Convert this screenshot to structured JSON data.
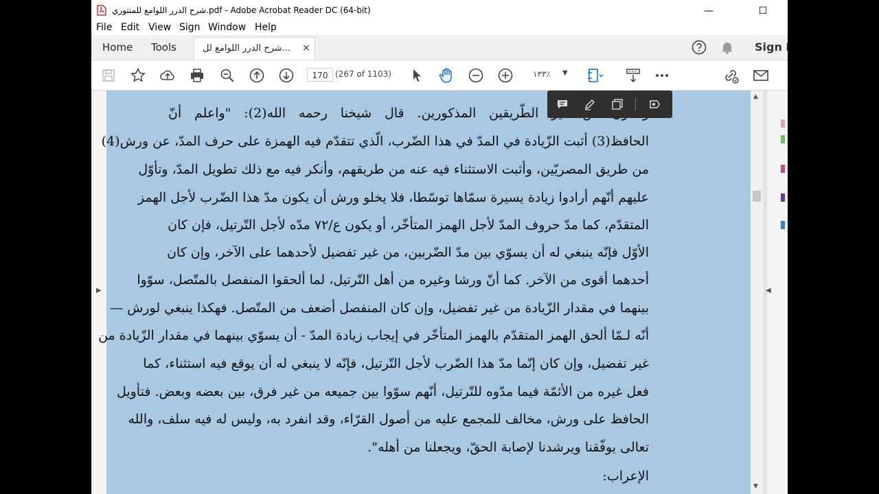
{
  "window": {
    "title": "شرح الدرر اللوامع للمنتوري.pdf - Adobe Acrobat Reader DC (64-bit)",
    "minimize": "—",
    "maximize": "☐"
  },
  "menu": [
    "File",
    "Edit",
    "View",
    "Sign",
    "Window",
    "Help"
  ],
  "tabs": {
    "home": "Home",
    "tools": "Tools",
    "document": "شرح الدرر اللوامع لل...",
    "close": "×",
    "sign_in": "Sign In"
  },
  "toolbar": {
    "page_current": "170",
    "page_count": "(267 of 1103)",
    "zoom": "١٣٣٪",
    "icons": [
      "save-icon",
      "bookmark-star-icon",
      "upload-icon",
      "print-icon",
      "search-zoom-icon",
      "page-up-icon",
      "page-down-icon",
      "select-cursor-icon",
      "hand-tool-icon",
      "zoom-out-icon",
      "zoom-in-icon",
      "page-fit-icon",
      "scroll-mode-icon",
      "more-icon",
      "share-link-icon",
      "email-icon"
    ]
  },
  "comment_bar": {
    "icons": [
      "comment-icon",
      "highlight-pen-icon",
      "copy-icon",
      "convert-icon"
    ]
  },
  "document_text": {
    "lines": [
      "وقالون من غير الطّريقين المذكورين. قال شيخنا رحمه الله(2): \"واعلم أنّ",
      "الحافظ(3) أثبت الزّيادة في المدّ في هذا الضّرب، الّذي تتقدّم فيه الهمزة على حرف المدّ، عن ورش(4)",
      "من طريق المصريّين، وأثبت الاستثناء فيه عنه من طريقهم، وأنكر فيه مع ذلك تطويل المدّ، وتأوّل",
      "عليهم أنّهم أرادوا زيادة يسيرة سمّاها توسّطا، فلا يخلو ورش أن يكون مدّ هذا الضّرب لأجل الهمز",
      "المتقدّم، كما مدّ حروف المدّ لأجل الهمز المتأخّر، أو يكون ع/٧٢ مدّه لأجل التّرتيل، فإن كان",
      "الأوّل فإنّه ينبغي له أن يسوّي بين مدّ الضّربين، من غير تفضيل لأحدهما على الآخر، وإن كان",
      "أحدهما أقوى من الآخر. كما أنّ ورشا وغيره من أهل التّرتيل، لما ألحقوا المنفصل بالمتّصل، سوّوا",
      "بينهما في مقدار الزّيادة من غير تفضيل، وإن كان المنفصل أضعف من المتّصل. فهكذا ينبغي لورش —",
      "أنّه لـمّا ألحق الهمز المتقدّم بالهمز المتأخّر في إيجاب زيادة المدّ - أن يسوّي بينهما في مقدار الزّيادة من",
      "غير تفضيل، وإن كان إنّما مدّ هذا الضّرب لأجل التّرتيل، فإنّه لا ينبغي له أن يوقع فيه استثناء، كما",
      "فعل غيره من الأئمّة فيما مدّوه للتّرتيل، أنّهم سوّوا بين جميعه من غير فرق، بين بعضه وبعض. فتأويل",
      "الحافظ على ورش، مخالف للمجمع عليه من أصول القرّاء، وقد انفرد به، وليس له فيه سلف، والله",
      "تعالى يوفّقنا ويرشدنا لإصابة الحقّ، ويجعلنا من أهله\".",
      "الإعراب:"
    ]
  },
  "colors": {
    "page_background": "#a9c8e2",
    "accent_blue": "#1a73c8",
    "dark_bar": "#2f2f2f"
  }
}
